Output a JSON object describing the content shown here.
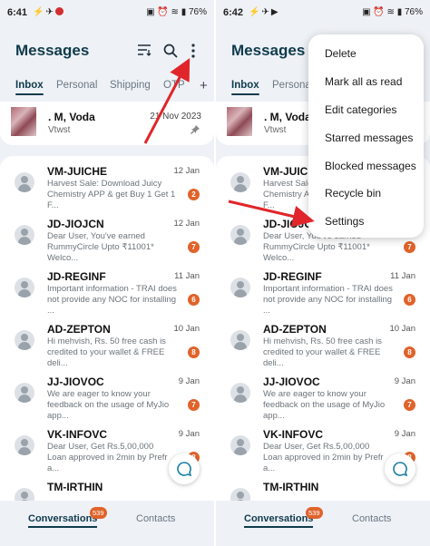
{
  "left": {
    "status": {
      "time": "6:41",
      "battery": "76%"
    },
    "fab": true
  },
  "right": {
    "status": {
      "time": "6:42",
      "battery": "76%"
    }
  },
  "app": {
    "title": "Messages",
    "tabs": [
      {
        "label": "Inbox",
        "active": true
      },
      {
        "label": "Personal"
      },
      {
        "label": "Shipping"
      },
      {
        "label": "OTP"
      }
    ],
    "tabs_right": [
      {
        "label": "Inbox"
      },
      {
        "label": "Personal"
      }
    ],
    "add_tab": "+"
  },
  "pinned": {
    "name": ". M, Voda",
    "snippet": "Vtwst",
    "date": "21 Nov 2023"
  },
  "conversations": [
    {
      "sender": "VM-JUICHE",
      "snippet": "Harvest Sale: Download Juicy\nChemistry APP & get Buy 1 Get 1 F...",
      "date": "12 Jan",
      "unread": "2"
    },
    {
      "sender": "JD-JIOJCN",
      "snippet": "Dear User,  You've earned\nRummyCircle Upto ₹11001* Welco...",
      "date": "12 Jan",
      "unread": "7"
    },
    {
      "sender": "JD-REGINF",
      "snippet": "Important information - TRAI does\nnot provide any NOC for installing ...",
      "date": "11 Jan",
      "unread": "6"
    },
    {
      "sender": "AD-ZEPTON",
      "snippet": "Hi mehvish, Rs. 50 free cash is\ncredited to your wallet & FREE deli...",
      "date": "10 Jan",
      "unread": "8"
    },
    {
      "sender": "JJ-JIOVOC",
      "snippet": "We are eager to know your\nfeedback on the usage of MyJio app...",
      "date": "9 Jan",
      "unread": "7"
    },
    {
      "sender": "VK-INFOVC",
      "snippet": "Dear User, Get Rs.5,00,000\nLoan approved in 2min by Prefr a...",
      "date": "9 Jan",
      "unread": "8"
    },
    {
      "sender": "TM-IRTHIN",
      "snippet": "",
      "date": "",
      "unread": ""
    }
  ],
  "bottom_nav": {
    "conversations": "Conversations",
    "conversations_badge": "539",
    "contacts": "Contacts"
  },
  "menu": {
    "items": [
      "Delete",
      "Mark all as read",
      "Edit categories",
      "Starred messages",
      "Blocked messages",
      "Recycle bin",
      "Settings"
    ]
  },
  "colors": {
    "title": "#0f3b4c",
    "badge": "#e0632a",
    "arrow": "#e0262b",
    "screen_bg": "#eef1f6"
  },
  "icons": [
    "filter-icon",
    "search-icon",
    "more-vert-icon",
    "pin-icon",
    "chat-fab-icon",
    "person-avatar-icon"
  ]
}
